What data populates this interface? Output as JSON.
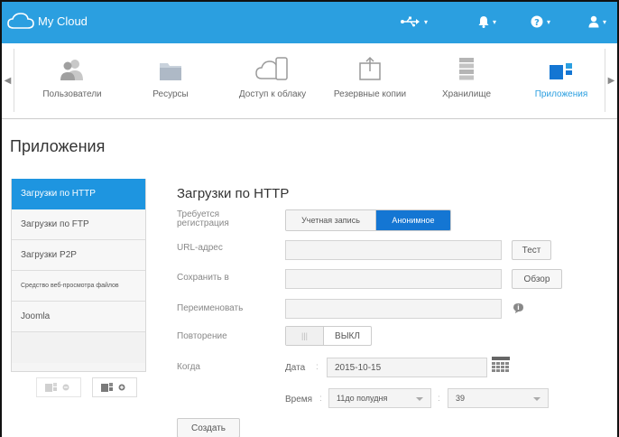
{
  "header": {
    "app_title": "My Cloud",
    "icons": [
      "usb-icon",
      "bell-icon",
      "help-icon",
      "user-icon"
    ]
  },
  "nav": {
    "items": [
      {
        "label": "Пользователи",
        "icon": "users-icon"
      },
      {
        "label": "Ресурсы",
        "icon": "shares-icon"
      },
      {
        "label": "Доступ к облаку",
        "icon": "cloud-access-icon"
      },
      {
        "label": "Резервные копии",
        "icon": "backup-icon"
      },
      {
        "label": "Хранилище",
        "icon": "storage-icon"
      },
      {
        "label": "Приложения",
        "icon": "apps-icon"
      }
    ],
    "active_index": 5
  },
  "page": {
    "title": "Приложения"
  },
  "sidebar": {
    "items": [
      {
        "label": "Загрузки по HTTP"
      },
      {
        "label": "Загрузки по FTP"
      },
      {
        "label": "Загрузки P2P"
      },
      {
        "label": "Средство веб-просмотра файлов"
      },
      {
        "label": "Joomla"
      }
    ],
    "active_index": 0
  },
  "content": {
    "title": "Загрузки по HTTP",
    "login_required_label": "Требуется регистрация",
    "login_options": {
      "account": "Учетная запись",
      "anonymous": "Анонимное"
    },
    "url_label": "URL-адрес",
    "test_button": "Тест",
    "save_to_label": "Сохранить в",
    "browse_button": "Обзор",
    "rename_label": "Переименовать",
    "repeat_label": "Повторение",
    "repeat_value": "ВЫКЛ",
    "when_label": "Когда",
    "date_label": "Дата",
    "date_value": "2015-10-15",
    "time_label": "Время",
    "hour_value": "11до полудня",
    "minute_value": "39",
    "create_button": "Создать"
  },
  "colors": {
    "accent": "#2b9fe0",
    "sidebar_active": "#1e95e0",
    "segment_active": "#1476d3"
  }
}
